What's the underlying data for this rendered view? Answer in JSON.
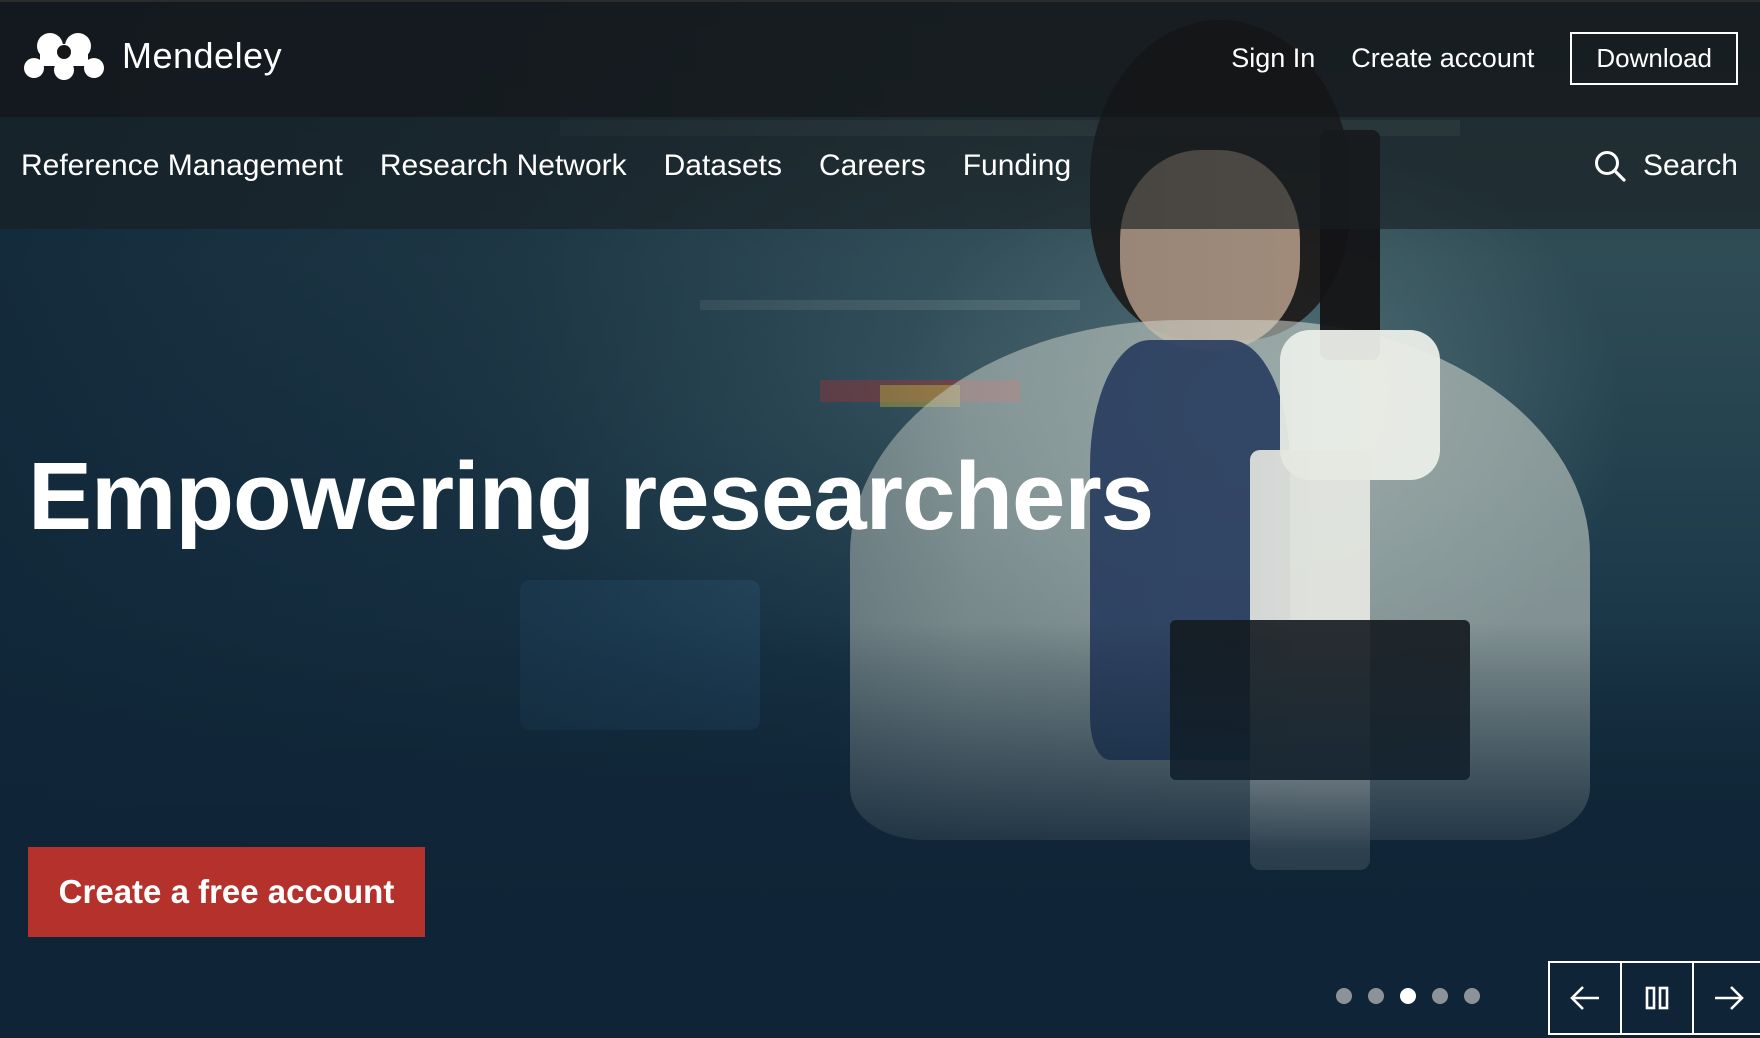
{
  "brand": {
    "name": "Mendeley",
    "logo_icon": "mendeley-logo-icon"
  },
  "header": {
    "sign_in": "Sign In",
    "create_account": "Create account",
    "download": "Download"
  },
  "nav": {
    "items": [
      {
        "label": "Reference Management"
      },
      {
        "label": "Research Network"
      },
      {
        "label": "Datasets"
      },
      {
        "label": "Careers"
      },
      {
        "label": "Funding"
      }
    ],
    "search_label": "Search",
    "search_icon": "search-icon"
  },
  "hero": {
    "headline": "Empowering researchers",
    "cta_label": "Create a free account"
  },
  "carousel": {
    "slide_count": 5,
    "active_index": 2,
    "controls": [
      "arrow-left-icon",
      "pause-icon",
      "arrow-right-icon"
    ]
  },
  "colors": {
    "cta_background": "#b5322c",
    "hero_background": "#0f2a3d",
    "topbar_background": "#141618"
  }
}
